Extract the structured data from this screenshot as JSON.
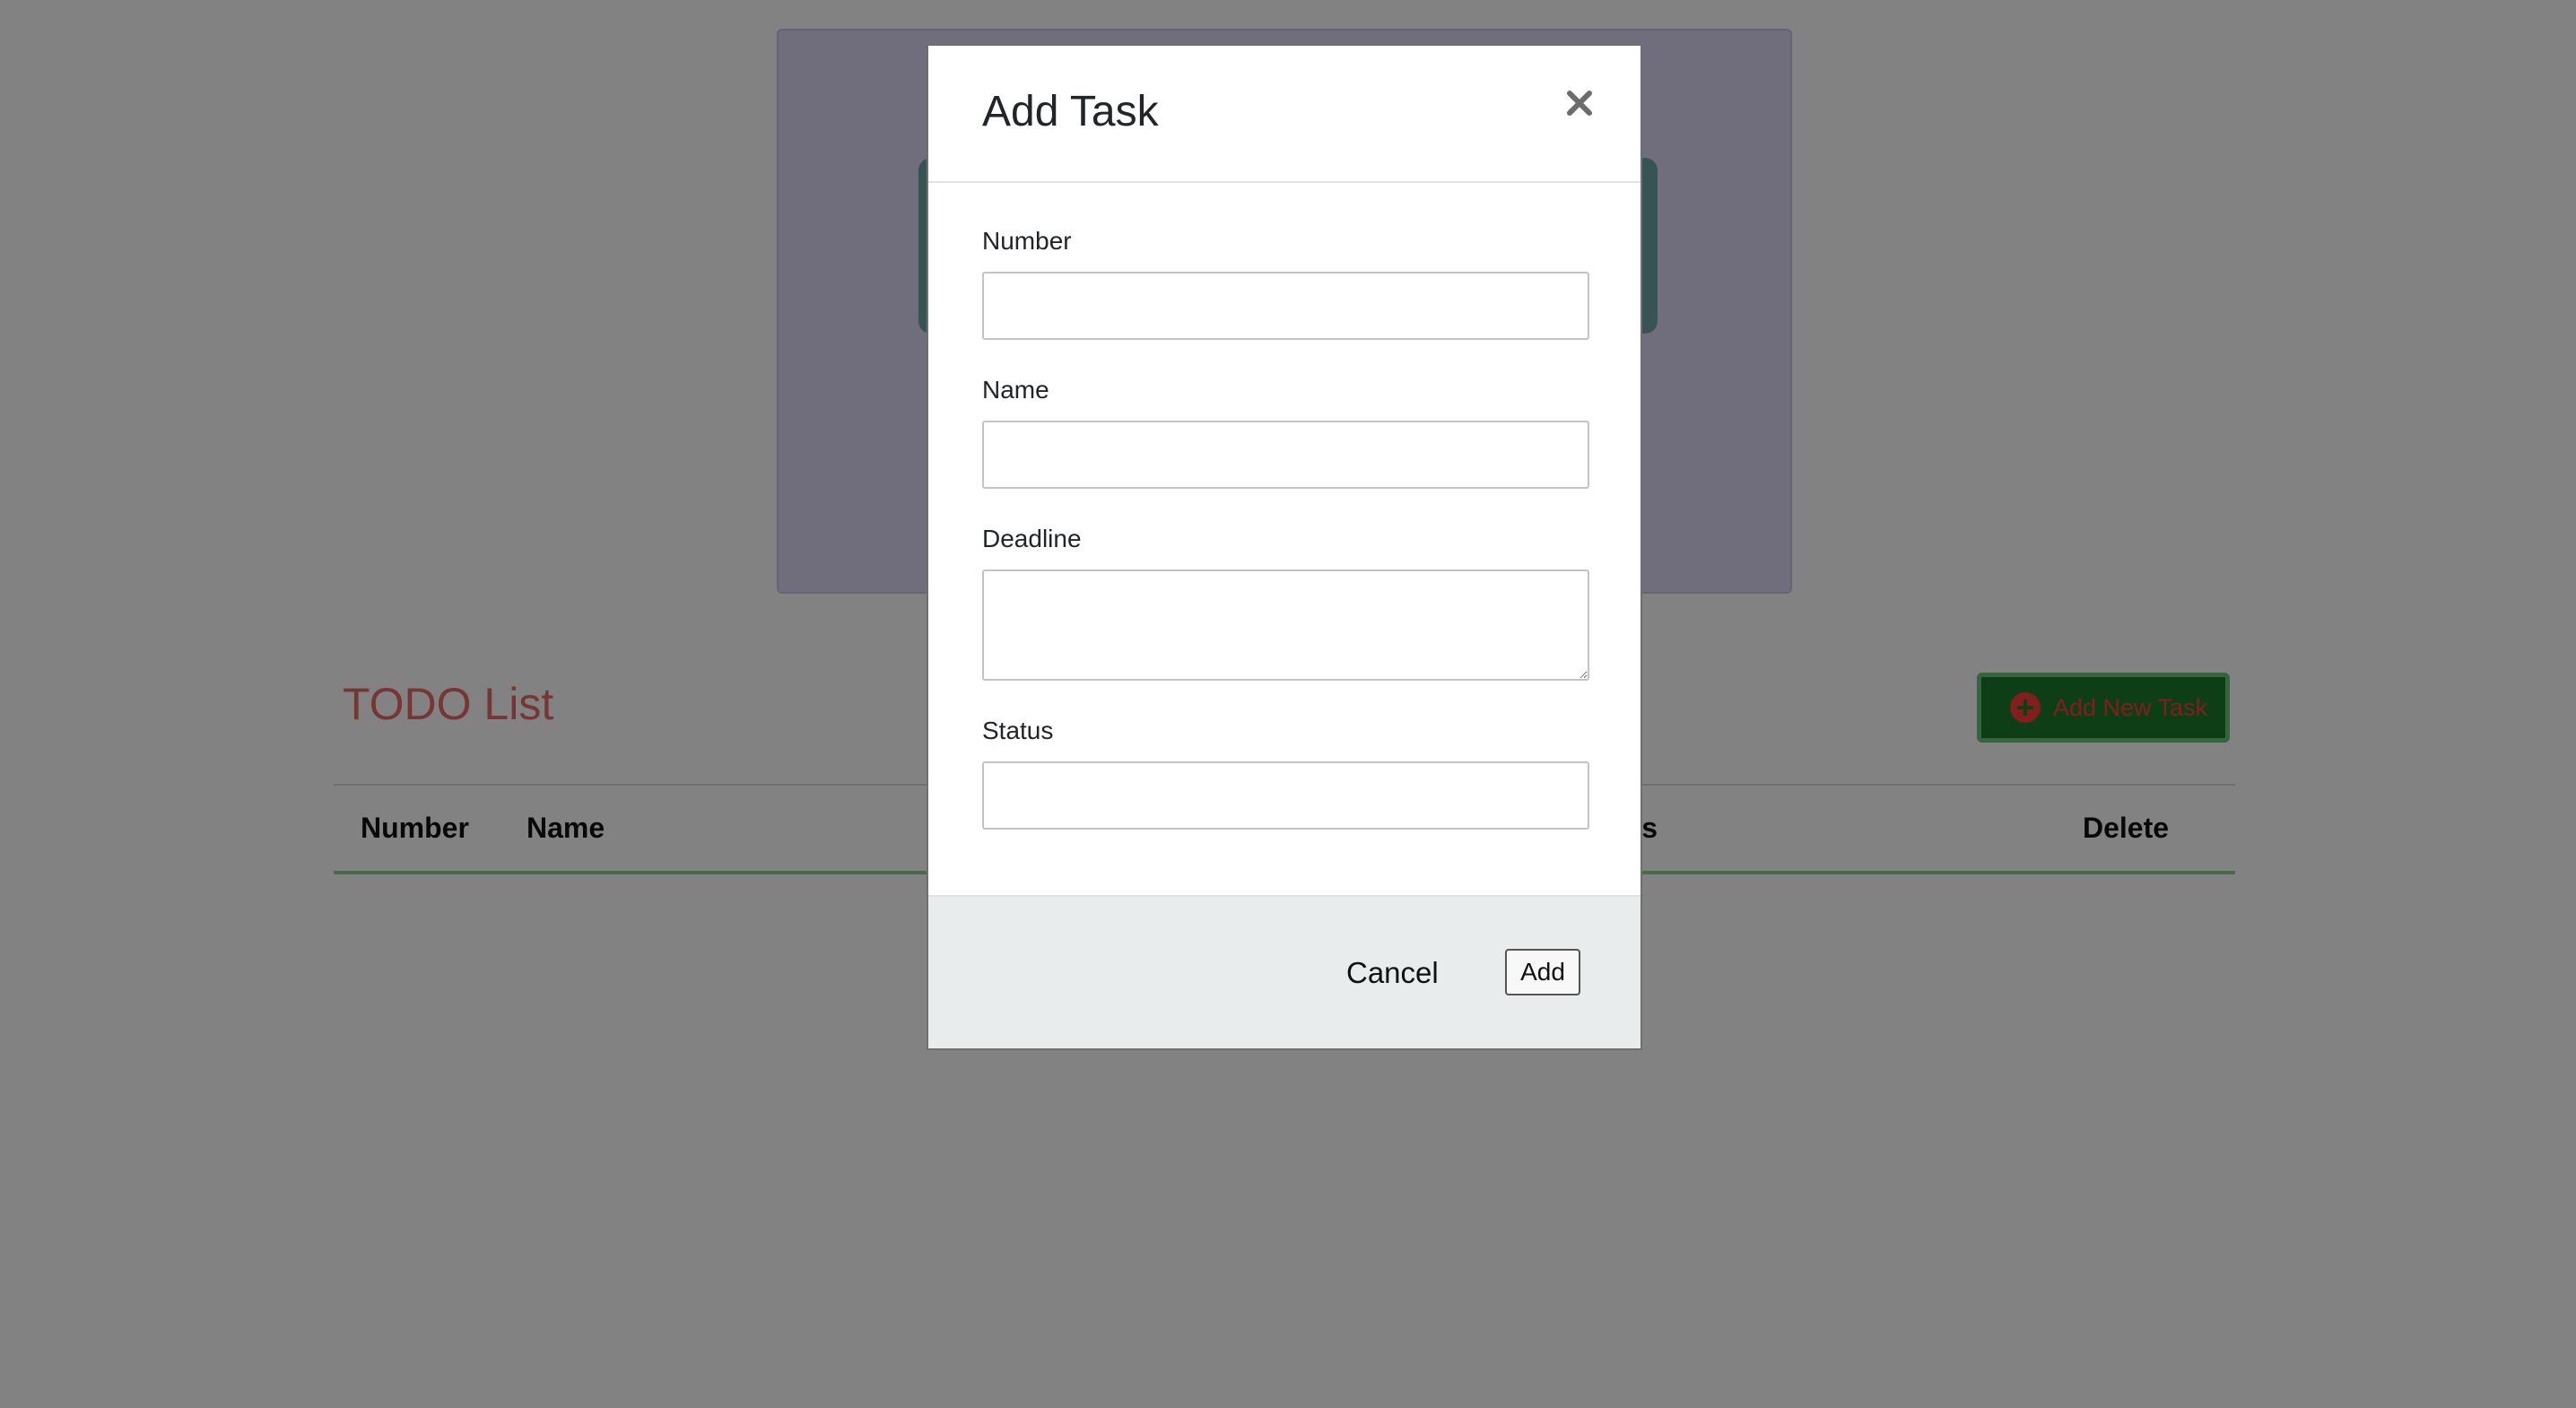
{
  "page": {
    "todo_title": "TODO List",
    "add_new_task_label": "Add New Task",
    "table_headers": {
      "number": "Number",
      "name": "Name",
      "status_partial": "tus",
      "delete": "Delete"
    }
  },
  "modal": {
    "title": "Add Task",
    "close_icon": "close-icon",
    "fields": {
      "number_label": "Number",
      "number_value": "",
      "name_label": "Name",
      "name_value": "",
      "deadline_label": "Deadline",
      "deadline_value": "",
      "status_label": "Status",
      "status_value": ""
    },
    "footer": {
      "cancel_label": "Cancel",
      "add_label": "Add"
    }
  },
  "colors": {
    "overlay": "rgba(0,0,0,0.49)",
    "todo_title": "#e86a6a",
    "add_button_bg": "#1a7a2a",
    "add_button_text": "#ff3b3b",
    "table_accent_line": "#8fd18e",
    "modal_footer_bg": "#e9ecec"
  }
}
